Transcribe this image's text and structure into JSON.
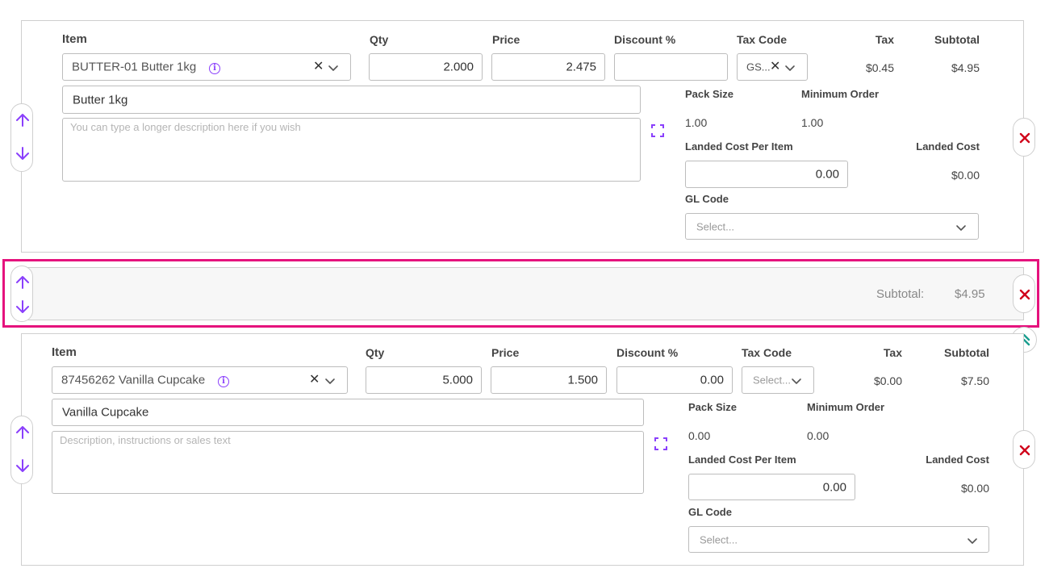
{
  "line1": {
    "headers": {
      "item": "Item",
      "qty": "Qty",
      "price": "Price",
      "discount": "Discount %",
      "tax_code": "Tax Code",
      "tax": "Tax",
      "subtotal": "Subtotal"
    },
    "item_value": "BUTTER-01 Butter 1kg",
    "qty": "2.000",
    "price": "2.475",
    "discount": "",
    "tax_code": "GS...",
    "tax": "$0.45",
    "subtotal": "$4.95",
    "name": "Butter 1kg",
    "description_placeholder": "You can type a longer description here if you wish",
    "pack_size_label": "Pack Size",
    "min_order_label": "Minimum Order",
    "pack_size": "1.00",
    "min_order": "1.00",
    "landed_cost_per_item_label": "Landed Cost Per Item",
    "landed_cost_label": "Landed Cost",
    "landed_cost_per_item": "0.00",
    "landed_cost": "$0.00",
    "gl_code_label": "GL Code",
    "gl_code_placeholder": "Select..."
  },
  "subtotal_row": {
    "label": "Subtotal:",
    "value": "$4.95"
  },
  "line2": {
    "headers": {
      "item": "Item",
      "qty": "Qty",
      "price": "Price",
      "discount": "Discount %",
      "tax_code": "Tax Code",
      "tax": "Tax",
      "subtotal": "Subtotal"
    },
    "item_value": "87456262 Vanilla Cupcake",
    "qty": "5.000",
    "price": "1.500",
    "discount": "0.00",
    "tax_code_placeholder": "Select...",
    "tax": "$0.00",
    "subtotal": "$7.50",
    "name": "Vanilla Cupcake",
    "description_placeholder": "Description, instructions or sales text",
    "pack_size_label": "Pack Size",
    "min_order_label": "Minimum Order",
    "pack_size": "0.00",
    "min_order": "0.00",
    "landed_cost_per_item_label": "Landed Cost Per Item",
    "landed_cost_label": "Landed Cost",
    "landed_cost_per_item": "0.00",
    "landed_cost": "$0.00",
    "gl_code_label": "GL Code",
    "gl_code_placeholder": "Select..."
  },
  "colors": {
    "accent_purple": "#8a3ffc",
    "delete_red": "#d0021b",
    "highlight_pink": "#e5127d",
    "teal": "#1a9e8f"
  }
}
